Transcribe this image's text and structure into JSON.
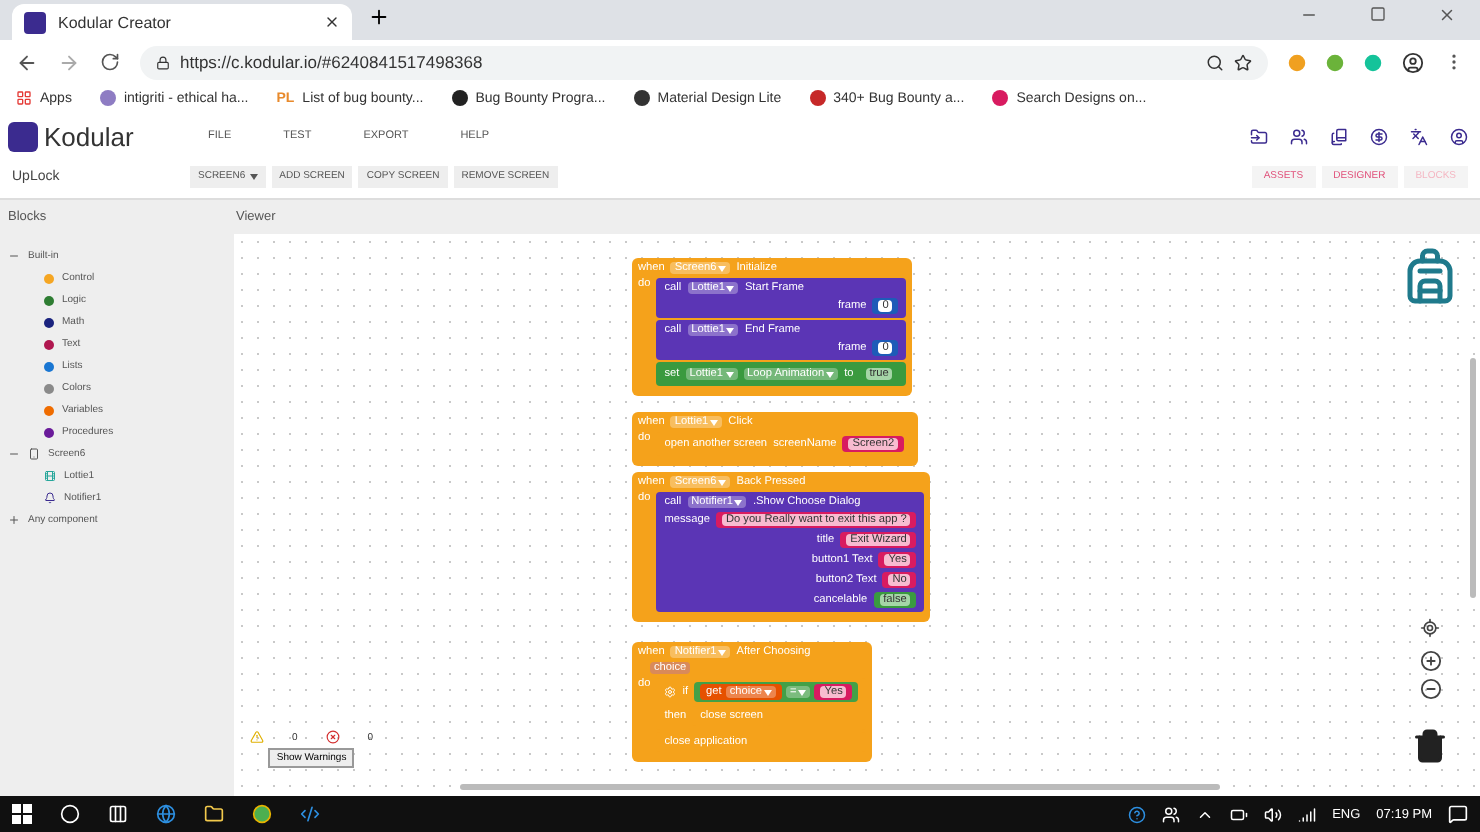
{
  "browser": {
    "tab_title": "Kodular Creator",
    "url": "https://c.kodular.io/#6240841517498368",
    "bookmarks": [
      {
        "label": "Apps"
      },
      {
        "label": "intigriti - ethical ha..."
      },
      {
        "label": "List of bug bounty...",
        "badge": "PL"
      },
      {
        "label": "Bug Bounty Progra..."
      },
      {
        "label": "Material Design Lite"
      },
      {
        "label": "340+ Bug Bounty a..."
      },
      {
        "label": "Search Designs on..."
      }
    ]
  },
  "app": {
    "logo": "Kodular",
    "menu": [
      "FILE",
      "TEST",
      "EXPORT",
      "HELP"
    ],
    "project": "UpLock",
    "screen_dropdown": "SCREEN6",
    "screen_actions": [
      "ADD SCREEN",
      "COPY SCREEN",
      "REMOVE SCREEN"
    ],
    "views": [
      {
        "label": "ASSETS",
        "selected": false
      },
      {
        "label": "DESIGNER",
        "selected": false
      },
      {
        "label": "BLOCKS",
        "selected": true
      }
    ]
  },
  "panels": {
    "blocks": "Blocks",
    "viewer": "Viewer"
  },
  "tree": [
    {
      "label": "Built-in",
      "expanded": true,
      "children": [
        {
          "label": "Control",
          "color": "#f5a623"
        },
        {
          "label": "Logic",
          "color": "#2e7d32"
        },
        {
          "label": "Math",
          "color": "#1a237e"
        },
        {
          "label": "Text",
          "color": "#b0174f"
        },
        {
          "label": "Lists",
          "color": "#1976d2"
        },
        {
          "label": "Colors",
          "color": "#8a8a8a"
        },
        {
          "label": "Variables",
          "color": "#ef6c00"
        },
        {
          "label": "Procedures",
          "color": "#6a1b9a"
        }
      ]
    },
    {
      "label": "Screen6",
      "expanded": true,
      "children": [
        {
          "label": "Lottie1"
        },
        {
          "label": "Notifier1"
        }
      ]
    },
    {
      "label": "Any component",
      "expanded": false
    }
  ],
  "events": [
    {
      "header": [
        {
          "kind": "word",
          "text": "when"
        },
        {
          "kind": "dropdown",
          "text": "Screen6"
        },
        {
          "kind": "word",
          "text": "Initialize"
        }
      ],
      "do": "do",
      "statements": [
        {
          "kind": "call",
          "head": [
            {
              "kind": "word",
              "text": "call"
            },
            {
              "kind": "dropdown",
              "text": "Lottie1"
            },
            {
              "kind": "word",
              "text": "Start Frame"
            }
          ],
          "args": [
            {
              "name": "frame",
              "value": {
                "kind": "number",
                "text": "0"
              }
            }
          ]
        },
        {
          "kind": "call",
          "head": [
            {
              "kind": "word",
              "text": "call"
            },
            {
              "kind": "dropdown",
              "text": "Lottie1"
            },
            {
              "kind": "word",
              "text": "End Frame"
            }
          ],
          "args": [
            {
              "name": "frame",
              "value": {
                "kind": "number",
                "text": "0"
              }
            }
          ]
        },
        {
          "kind": "set",
          "head": [
            {
              "kind": "word",
              "text": "set"
            },
            {
              "kind": "dropdown",
              "text": "Lottie1"
            },
            {
              "kind": "dropdown",
              "text": "Loop Animation"
            },
            {
              "kind": "word",
              "text": "to"
            },
            {
              "kind": "bool",
              "text": "true"
            }
          ]
        }
      ]
    },
    {
      "header": [
        {
          "kind": "word",
          "text": "when"
        },
        {
          "kind": "dropdown",
          "text": "Lottie1"
        },
        {
          "kind": "word",
          "text": "Click"
        }
      ],
      "do": "do",
      "statements": [
        {
          "kind": "control",
          "head": [
            {
              "kind": "word",
              "text": "open another screen"
            },
            {
              "kind": "word",
              "text": "screenName"
            },
            {
              "kind": "string",
              "text": "Screen2"
            }
          ]
        }
      ]
    },
    {
      "header": [
        {
          "kind": "word",
          "text": "when"
        },
        {
          "kind": "dropdown",
          "text": "Screen6"
        },
        {
          "kind": "word",
          "text": "Back Pressed"
        }
      ],
      "do": "do",
      "statements": [
        {
          "kind": "call",
          "head": [
            {
              "kind": "word",
              "text": "call"
            },
            {
              "kind": "dropdown",
              "text": "Notifier1"
            },
            {
              "kind": "word",
              "text": ".Show Choose Dialog"
            }
          ],
          "args": [
            {
              "name": "message",
              "value": {
                "kind": "string",
                "text": "Do you Really want to exit this app ?"
              }
            },
            {
              "name": "title",
              "value": {
                "kind": "string",
                "text": "Exit Wizard"
              }
            },
            {
              "name": "button1 Text",
              "value": {
                "kind": "string",
                "text": "Yes"
              }
            },
            {
              "name": "button2 Text",
              "value": {
                "kind": "string",
                "text": "No"
              }
            },
            {
              "name": "cancelable",
              "value": {
                "kind": "bool",
                "text": "false"
              }
            }
          ]
        }
      ]
    },
    {
      "header": [
        {
          "kind": "word",
          "text": "when"
        },
        {
          "kind": "dropdown",
          "text": "Notifier1"
        },
        {
          "kind": "word",
          "text": "After Choosing"
        }
      ],
      "param": "choice",
      "do": "do",
      "statements": [
        {
          "kind": "if",
          "word": "if",
          "condition": [
            {
              "kind": "get",
              "word": "get",
              "var": "choice"
            },
            {
              "kind": "dropdown",
              "text": "="
            },
            {
              "kind": "string",
              "text": "Yes"
            }
          ],
          "then": "then",
          "then_statements": [
            {
              "kind": "control",
              "head": [
                {
                  "kind": "word",
                  "text": "close screen"
                }
              ]
            }
          ]
        },
        {
          "kind": "control",
          "head": [
            {
              "kind": "word",
              "text": "close application"
            }
          ]
        }
      ]
    }
  ],
  "warnings": {
    "warning_count": "0",
    "error_count": "0",
    "button": "Show Warnings"
  },
  "taskbar": {
    "language": "ENG",
    "time": "07:19 PM"
  }
}
